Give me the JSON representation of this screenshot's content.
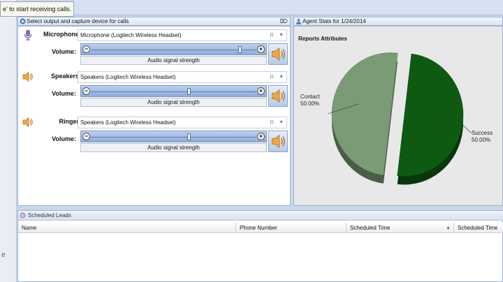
{
  "tooltip": {
    "text": "e' to start receiving calls."
  },
  "left_strip": {
    "letter": "e"
  },
  "device_panel": {
    "title": "Select output and capture device for calls",
    "pin": "⌦",
    "volume_label": "Volume:",
    "signal_label": "Audio signal strength",
    "devices": [
      {
        "label": "Microphone",
        "icon": "microphone-icon",
        "value": "Microphone (Logitech Wireless Headset)",
        "r": "R",
        "level": 0.91
      },
      {
        "label": "Speakers",
        "icon": "speaker-icon",
        "value": "Speakers (Logitech Wireless Headset)",
        "r": "R",
        "level": 0.59
      },
      {
        "label": "Ringer",
        "icon": "speaker-icon",
        "value": "Speakers (Logitech Wireless Headset)",
        "r": "R",
        "level": 0.59
      }
    ]
  },
  "stats_panel": {
    "title": "Agent Stats for 1/24/2014",
    "chart_title": "Reports Attributes"
  },
  "chart_data": {
    "type": "pie",
    "title": "Reports Attributes",
    "slices": [
      {
        "name": "Contact",
        "value": 50.0,
        "label": "50.00%",
        "color": "#0f5a12"
      },
      {
        "name": "Success",
        "value": 50.0,
        "label": "50.00%",
        "color": "#7a9b76"
      }
    ],
    "legend": "none"
  },
  "leads_panel": {
    "title": "Scheduled Leads",
    "columns": [
      "Name",
      "Phone Number",
      "Scheduled Time",
      "Scheduled Time"
    ]
  },
  "colors": {
    "accent": "#c9d7ec",
    "contact": "#0f5a12",
    "success": "#7a9b76"
  }
}
